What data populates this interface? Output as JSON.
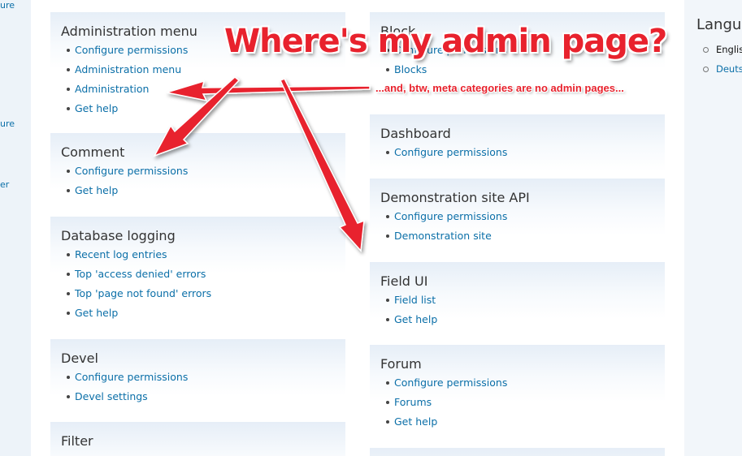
{
  "left_fragments": [
    "ure",
    "ure",
    "er"
  ],
  "panels": [
    {
      "title": "Administration menu",
      "links": [
        "Configure permissions",
        "Administration menu",
        "Administration",
        "Get help"
      ]
    },
    {
      "title": "Comment",
      "links": [
        "Configure permissions",
        "Get help"
      ]
    },
    {
      "title": "Database logging",
      "links": [
        "Recent log entries",
        "Top 'access denied' errors",
        "Top 'page not found' errors",
        "Get help"
      ]
    },
    {
      "title": "Devel",
      "links": [
        "Configure permissions",
        "Devel settings"
      ]
    },
    {
      "title": "Filter",
      "links": []
    },
    {
      "title": "Block",
      "links": [
        "Configure permissions",
        "Blocks"
      ]
    },
    {
      "title": "Dashboard",
      "links": [
        "Configure permissions"
      ]
    },
    {
      "title": "Demonstration site API",
      "links": [
        "Configure permissions",
        "Demonstration site"
      ]
    },
    {
      "title": "Field UI",
      "links": [
        "Field list",
        "Get help"
      ]
    },
    {
      "title": "Forum",
      "links": [
        "Configure permissions",
        "Forums",
        "Get help"
      ]
    }
  ],
  "language_block": {
    "title": "Langu",
    "items": [
      "Englis",
      "Deuts"
    ]
  },
  "annotation": {
    "title": "Where's my admin page?",
    "subtitle": "...and, btw, meta categories are no admin pages..."
  },
  "colors": {
    "link": "#0b6fa8",
    "annotation": "#e8222d"
  }
}
